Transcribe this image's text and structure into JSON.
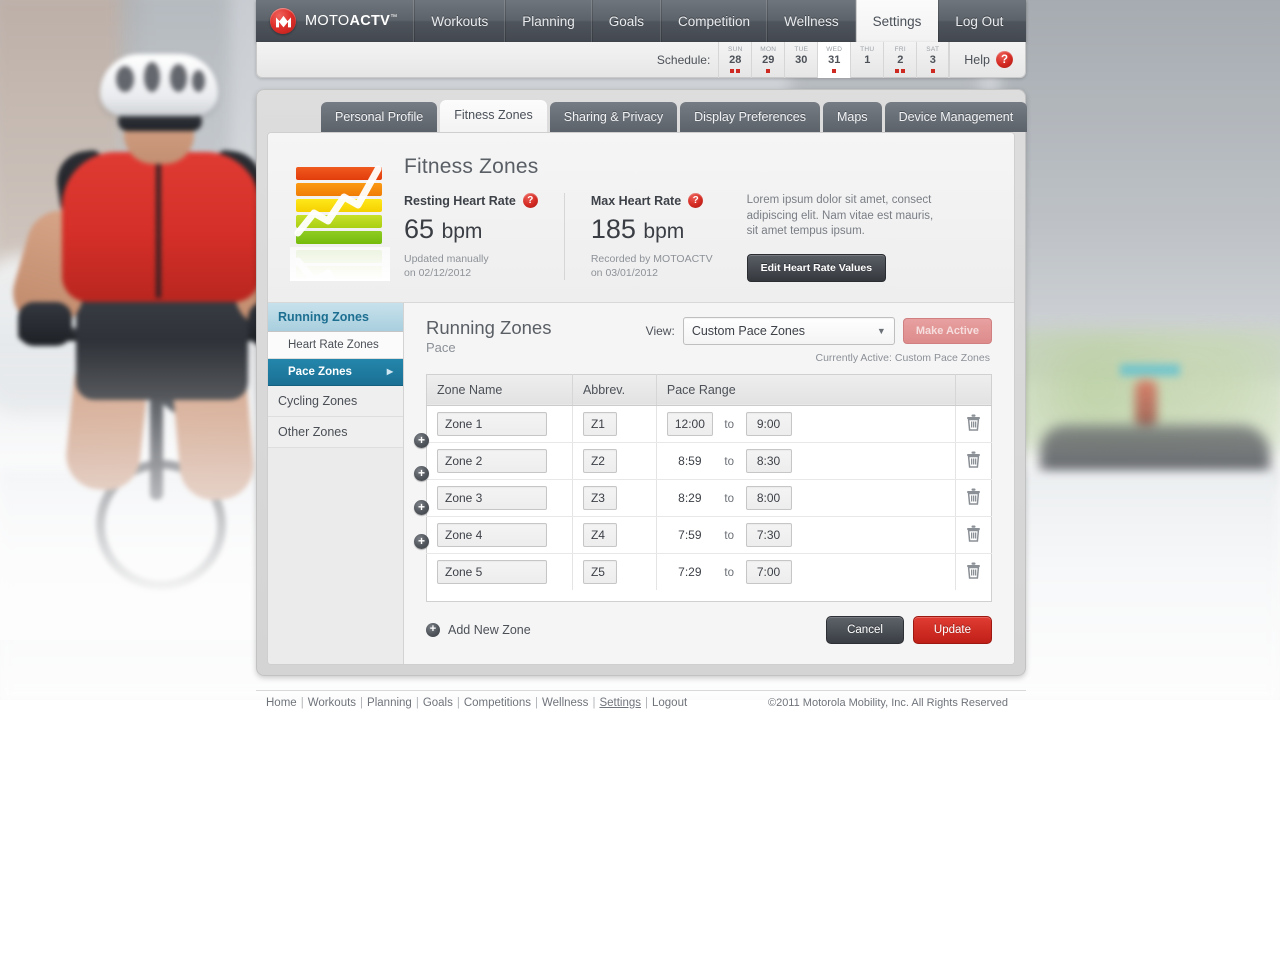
{
  "brand": {
    "prefix": "MOTO",
    "bold": "ACTV",
    "tm": "™",
    "logo_icon": "motorola-m-icon",
    "accent": "#d32a22"
  },
  "topnav": {
    "items": [
      {
        "label": "Workouts",
        "active": false
      },
      {
        "label": "Planning",
        "active": false
      },
      {
        "label": "Goals",
        "active": false
      },
      {
        "label": "Competition",
        "active": false
      },
      {
        "label": "Wellness",
        "active": false
      },
      {
        "label": "Settings",
        "active": true
      },
      {
        "label": "Log Out",
        "active": false
      }
    ]
  },
  "schedule": {
    "label": "Schedule:",
    "days": [
      {
        "dow": "SUN",
        "num": "28",
        "dots": 2,
        "today": false
      },
      {
        "dow": "MON",
        "num": "29",
        "dots": 1,
        "today": false
      },
      {
        "dow": "TUE",
        "num": "30",
        "dots": 0,
        "today": false
      },
      {
        "dow": "WED",
        "num": "31",
        "dots": 1,
        "today": true
      },
      {
        "dow": "THU",
        "num": "1",
        "dots": 0,
        "today": false
      },
      {
        "dow": "FRI",
        "num": "2",
        "dots": 2,
        "today": false
      },
      {
        "dow": "SAT",
        "num": "3",
        "dots": 1,
        "today": false
      }
    ],
    "help_label": "Help",
    "help_icon": "question-mark-icon"
  },
  "tabs": [
    {
      "label": "Personal Profile",
      "active": false
    },
    {
      "label": "Fitness Zones",
      "active": true
    },
    {
      "label": "Sharing & Privacy",
      "active": false
    },
    {
      "label": "Display Preferences",
      "active": false
    },
    {
      "label": "Maps",
      "active": false
    },
    {
      "label": "Device Management",
      "active": false
    }
  ],
  "summary": {
    "icon": "fitness-zones-bar-chart-icon",
    "title": "Fitness Zones",
    "resting": {
      "label": "Resting Heart Rate",
      "help_icon": "question-mark-icon",
      "value": "65",
      "unit": "bpm",
      "sub_line1": "Updated manually",
      "sub_line2": "on 02/12/2012"
    },
    "max": {
      "label": "Max Heart Rate",
      "help_icon": "question-mark-icon",
      "value": "185",
      "unit": "bpm",
      "sub_line1": "Recorded by MOTOACTV",
      "sub_line2": "on 03/01/2012"
    },
    "description": "Lorem ipsum dolor sit amet, consect adipiscing elit. Nam vitae est mauris, sit amet tempus ipsum.",
    "edit_button": "Edit Heart Rate Values"
  },
  "sidebar": {
    "group_label": "Running Zones",
    "items": [
      {
        "label": "Heart Rate Zones",
        "type": "sub",
        "selected": false
      },
      {
        "label": "Pace Zones",
        "type": "sub",
        "selected": true
      },
      {
        "label": "Cycling Zones",
        "type": "group",
        "selected": false
      },
      {
        "label": "Other Zones",
        "type": "group",
        "selected": false
      }
    ],
    "arrow_icon": "chevron-right-icon"
  },
  "content": {
    "title": "Running Zones",
    "subtitle": "Pace",
    "view_label": "View:",
    "view_selected": "Custom Pace Zones",
    "view_chevron": "chevron-down-icon",
    "make_active_label": "Make Active",
    "currently_active": "Currently Active: Custom Pace Zones"
  },
  "table": {
    "headers": [
      "Zone Name",
      "Abbrev.",
      "Pace Range",
      ""
    ],
    "to_word": "to",
    "delete_icon": "trash-icon",
    "add_row_icon": "plus-circle-icon",
    "rows": [
      {
        "name": "Zone 1",
        "abbrev": "Z1",
        "from": "12:00",
        "to": "9:00",
        "from_editable": true
      },
      {
        "name": "Zone 2",
        "abbrev": "Z2",
        "from": "8:59",
        "to": "8:30",
        "from_editable": false
      },
      {
        "name": "Zone 3",
        "abbrev": "Z3",
        "from": "8:29",
        "to": "8:00",
        "from_editable": false
      },
      {
        "name": "Zone 4",
        "abbrev": "Z4",
        "from": "7:59",
        "to": "7:30",
        "from_editable": false
      },
      {
        "name": "Zone 5",
        "abbrev": "Z5",
        "from": "7:29",
        "to": "7:00",
        "from_editable": false
      }
    ]
  },
  "actions": {
    "add_new_zone": "Add New Zone",
    "add_icon": "plus-circle-icon",
    "cancel": "Cancel",
    "update": "Update",
    "update_color": "#d0231a"
  },
  "footer": {
    "links": [
      "Home",
      "Workouts",
      "Planning",
      "Goals",
      "Competitions",
      "Wellness",
      "Settings",
      "Logout"
    ],
    "current": "Settings",
    "copyright": "©2011 Motorola Mobility, Inc. All Rights Reserved"
  }
}
